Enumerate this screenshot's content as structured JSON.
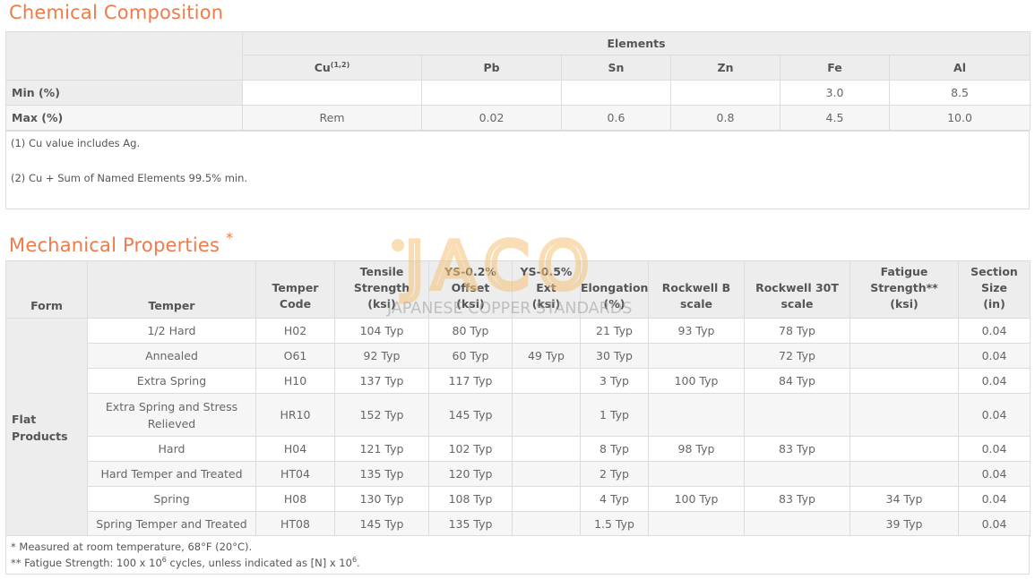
{
  "chem": {
    "title": "Chemical Composition",
    "group_header": "Elements",
    "columns": [
      {
        "sym": "Cu",
        "sup": "(1,2)"
      },
      {
        "sym": "Pb",
        "sup": ""
      },
      {
        "sym": "Sn",
        "sup": ""
      },
      {
        "sym": "Zn",
        "sup": ""
      },
      {
        "sym": "Fe",
        "sup": ""
      },
      {
        "sym": "Al",
        "sup": ""
      }
    ],
    "rows": [
      {
        "label": "Min (%)",
        "values": [
          "",
          "",
          "",
          "",
          "3.0",
          "8.5"
        ]
      },
      {
        "label": "Max (%)",
        "values": [
          "Rem",
          "0.02",
          "0.6",
          "0.8",
          "4.5",
          "10.0"
        ]
      }
    ],
    "notes": [
      "(1) Cu value includes Ag.",
      "(2) Cu + Sum of Named Elements 99.5% min."
    ]
  },
  "mech": {
    "title": "Mechanical Properties",
    "title_mark": "*",
    "headers": {
      "form": "Form",
      "temper": "Temper",
      "temper_code": [
        "Temper",
        "Code"
      ],
      "tensile": [
        "Tensile",
        "Strength",
        "(ksi)"
      ],
      "ys02": [
        "YS-0.2%",
        "Offset",
        "(ksi)"
      ],
      "ys05": [
        "YS-0.5%",
        "Ext",
        "(ksi)"
      ],
      "elong": [
        "Elongation",
        "(%)"
      ],
      "rockb": [
        "Rockwell B",
        "scale"
      ],
      "rock30": [
        "Rockwell 30T",
        "scale"
      ],
      "fatigue": [
        "Fatigue",
        "Strength**",
        "(ksi)"
      ],
      "section": [
        "Section",
        "Size",
        "(in)"
      ]
    },
    "form_label": [
      "Flat",
      "Products"
    ],
    "rows": [
      [
        "1/2 Hard",
        "H02",
        "104 Typ",
        "80 Typ",
        "",
        "21 Typ",
        "93 Typ",
        "78 Typ",
        "",
        "0.04"
      ],
      [
        "Annealed",
        "O61",
        "92 Typ",
        "60 Typ",
        "49 Typ",
        "30 Typ",
        "",
        "72 Typ",
        "",
        "0.04"
      ],
      [
        "Extra Spring",
        "H10",
        "137 Typ",
        "117 Typ",
        "",
        "3 Typ",
        "100 Typ",
        "84 Typ",
        "",
        "0.04"
      ],
      [
        "Extra Spring and Stress Relieved",
        "HR10",
        "152 Typ",
        "145 Typ",
        "",
        "1 Typ",
        "",
        "",
        "",
        "0.04"
      ],
      [
        "Hard",
        "H04",
        "121 Typ",
        "102 Typ",
        "",
        "8 Typ",
        "98 Typ",
        "83 Typ",
        "",
        "0.04"
      ],
      [
        "Hard Temper and Treated",
        "HT04",
        "135 Typ",
        "120 Typ",
        "",
        "2 Typ",
        "",
        "",
        "",
        "0.04"
      ],
      [
        "Spring",
        "H08",
        "130 Typ",
        "108 Typ",
        "",
        "4 Typ",
        "100 Typ",
        "83 Typ",
        "34 Typ",
        "0.04"
      ],
      [
        "Spring Temper and Treated",
        "HT08",
        "145 Typ",
        "135 Typ",
        "",
        "1.5 Typ",
        "",
        "",
        "39 Typ",
        "0.04"
      ]
    ],
    "notes": {
      "n1": "* Measured at room temperature, 68°F (20°C).",
      "n2_a": "** Fatigue Strength: 100 x 10",
      "n2_sup1": "6",
      "n2_b": " cycles, unless indicated as [N] x 10",
      "n2_sup2": "6",
      "n2_c": "."
    }
  },
  "watermark": {
    "brand": "JACO",
    "tagline": "JAPANESE COPPER STANDARDS",
    "color": "#f5c27a"
  }
}
